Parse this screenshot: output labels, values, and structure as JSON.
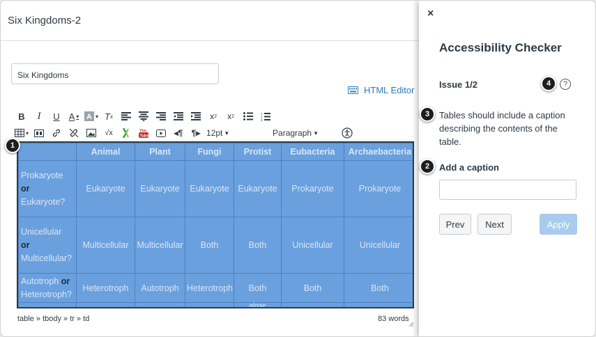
{
  "editor": {
    "page_title": "Six Kingdoms-2",
    "title_value": "Six Kingdoms",
    "html_editor_label": "HTML Editor",
    "font_size": "12pt",
    "block_format": "Paragraph",
    "status_path": "table » tbody » tr » td",
    "word_count": "83 words"
  },
  "table": {
    "headers": [
      "",
      "Animal",
      "Plant",
      "Fungi",
      "Protist",
      "Eubacteria",
      "Archaebacteria"
    ],
    "rows": [
      {
        "label_a": "Prokaryote",
        "label_or": "or",
        "label_b": "Eukaryote?",
        "cells": [
          "Eukaryote",
          "Eukaryote",
          "Eukaryote",
          "Eukaryote",
          "Prokaryote",
          "Prokaryote"
        ]
      },
      {
        "label_a": "Unicellular",
        "label_or": "or",
        "label_b": "Multicellular?",
        "cells": [
          "Multicellular",
          "Multicellular",
          "Both",
          "Both",
          "Unicellular",
          "Unicellular"
        ]
      },
      {
        "label_a": "Autotroph",
        "label_or": "or",
        "label_b": "Heterotroph?",
        "cells": [
          "Heterotroph",
          "Autotroph",
          "Heterotroph",
          "Both",
          "Both",
          "Both"
        ]
      }
    ],
    "overflow_text": "algae"
  },
  "panel": {
    "close_glyph": "×",
    "title": "Accessibility Checker",
    "issue": "Issue 1/2",
    "help_glyph": "?",
    "description": "Tables should include a caption describing the contents of the table.",
    "caption_label": "Add a caption",
    "caption_value": "",
    "prev": "Prev",
    "next": "Next",
    "apply": "Apply"
  },
  "callouts": [
    "1",
    "2",
    "3",
    "4"
  ],
  "colors": {
    "table_fill": "#6aa0dd",
    "link_blue": "#2b7abc",
    "apply_disabled": "#a8cbee",
    "text_dark": "#2d3b45"
  }
}
